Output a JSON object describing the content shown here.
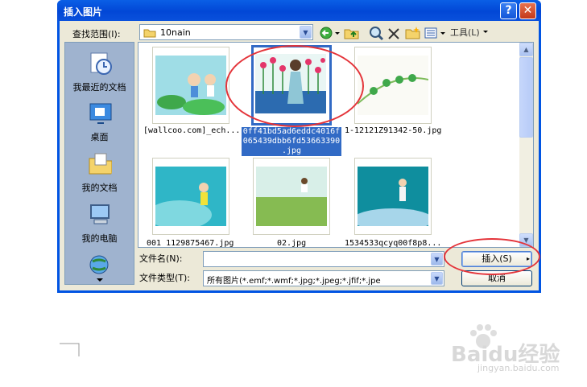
{
  "dialog": {
    "title": "插入图片",
    "help_glyph": "?",
    "close_glyph": "✕"
  },
  "toolbar": {
    "lookin_label": "查找范围(I):",
    "lookin_value": "10nain",
    "tools_label": "工具(L)"
  },
  "places": [
    {
      "label": "我最近的文档",
      "icon": "recent-docs-icon"
    },
    {
      "label": "桌面",
      "icon": "desktop-icon"
    },
    {
      "label": "我的文档",
      "icon": "my-documents-icon"
    },
    {
      "label": "我的电脑",
      "icon": "my-computer-icon"
    }
  ],
  "files": [
    {
      "name": "[wallcoo.com]_ech...",
      "selected": false
    },
    {
      "name": "0ff41bd5ad6eddc4016f065439dbb6fd53663390.jpg",
      "name_lines": [
        "0ff41bd5ad6eddc4016f",
        "065439dbb6fd53663390",
        ".jpg"
      ],
      "selected": true
    },
    {
      "name": "1-12121Z91342-50.jpg",
      "selected": false
    },
    {
      "name": "001_1129875467.jpg",
      "selected": false
    },
    {
      "name": "02.jpg",
      "selected": false
    },
    {
      "name": "1534533qcyq00f8p8...",
      "selected": false
    }
  ],
  "form": {
    "filename_label": "文件名(N):",
    "filename_value": "",
    "filetype_label": "文件类型(T):",
    "filetype_value": "所有图片(*.emf;*.wmf;*.jpg;*.jpeg;*.jfif;*.jpe"
  },
  "buttons": {
    "insert": "插入(S)",
    "cancel": "取消"
  },
  "watermark": {
    "brand": "Baidu经验",
    "url": "jingyan.baidu.com"
  },
  "colors": {
    "titlebar": "#0247d6",
    "selection": "#316ac5",
    "annotation": "#e4343a"
  }
}
